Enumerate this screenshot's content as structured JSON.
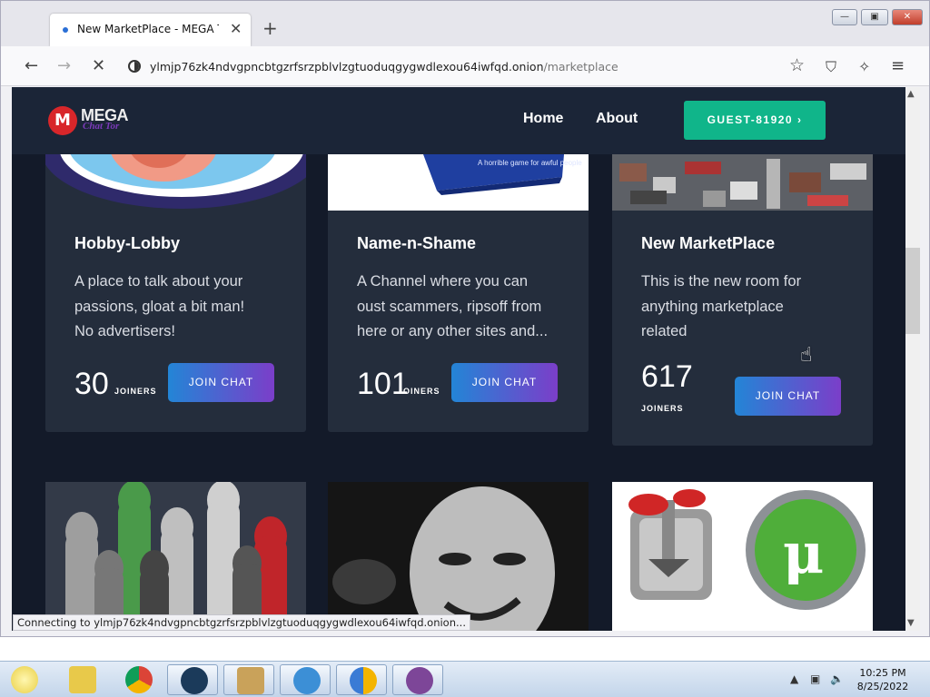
{
  "browser": {
    "tab_title": "New MarketPlace - MEGA Tor",
    "tab_close": "✕",
    "new_tab": "+",
    "url_host": "ylmjp76zk4ndvgpncbtgzrfsrzpblvlzgtuoduqgygwdlexou64iwfqd.onion",
    "url_path": "/marketplace",
    "status_text": "Connecting to ylmjp76zk4ndvgpncbtgzrfsrzpblvlzgtuoduqgygwdlexou64iwfqd.onion..."
  },
  "site": {
    "logo_mark": "M",
    "logo_text": "MEGA",
    "logo_sub": "Chat Tor",
    "nav": [
      "Home",
      "About"
    ],
    "guest_label": "GUEST-81920 ›"
  },
  "cards": [
    {
      "title": "Hobby-Lobby",
      "desc": [
        "A place to talk about your",
        "passions, gloat a bit man!",
        "No advertisers!"
      ],
      "count": "30",
      "count_label": "JOINERS",
      "button": "JOIN CHAT"
    },
    {
      "title": "Name-n-Shame",
      "desc": [
        "A Channel where you can",
        "oust scammers, ripsoff from",
        "here or any other sites and..."
      ],
      "count": "101",
      "count_label": "JOINERS",
      "button": "JOIN CHAT",
      "image_caption": "A horrible game for awful people"
    },
    {
      "title": "New MarketPlace",
      "desc": [
        "This is the new room for",
        "anything marketplace",
        "related"
      ],
      "count": "617",
      "count_label": "JOINERS",
      "button": "JOIN CHAT"
    }
  ],
  "taskbar": {
    "time": "10:25 PM",
    "date": "8/25/2022"
  },
  "colors": {
    "accent": "#10b58a",
    "button_start": "#2385d6",
    "button_end": "#7b3ec9",
    "page_bg": "#131a29",
    "card_bg": "#242d3c"
  }
}
